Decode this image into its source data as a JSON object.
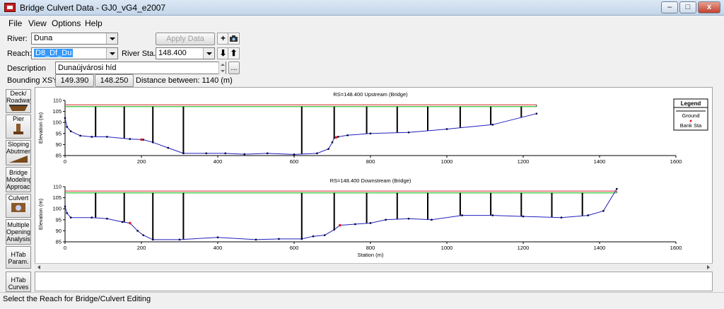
{
  "window": {
    "title": "Bridge Culvert Data - GJ0_vG4_e2007",
    "minimize": "–",
    "maximize": "□",
    "close": "x"
  },
  "menu": [
    "File",
    "View",
    "Options",
    "Help"
  ],
  "form": {
    "river_label": "River:",
    "river_value": "Duna",
    "reach_label": "Reach:",
    "reach_value": "D8_Df_Du",
    "river_sta_label": "River Sta.:",
    "river_sta_value": "148.400",
    "apply_button": "Apply Data",
    "description_label": "Description",
    "description_value": "Dunaújvárosi híd",
    "bounding_label": "Bounding XS's:",
    "bounding_upstream": "149.390",
    "bounding_downstream": "148.250",
    "distance_text": "Distance between: 1140 (m)"
  },
  "sidebar": [
    {
      "label": "Deck/ Roadway",
      "icon": "deck-icon"
    },
    {
      "label": "Pier",
      "icon": "pier-icon"
    },
    {
      "label": "Sloping Abutment",
      "icon": "abutment-icon"
    },
    {
      "label": "Bridge Modeling Approach",
      "icon": ""
    },
    {
      "label": "Culvert",
      "icon": "culvert-icon"
    },
    {
      "label": "Multiple Opening Analysis",
      "icon": ""
    },
    {
      "label": "HTab Param.",
      "icon": ""
    },
    {
      "label": "HTab Curves",
      "icon": ""
    }
  ],
  "legend": {
    "title": "Legend",
    "items": [
      "Ground",
      "Bank Sta"
    ]
  },
  "colors": {
    "ground": "#2020c0",
    "bank": "#e02020",
    "deck_top": "#e05050",
    "deck_bottom": "#30c030",
    "pier": "#000000"
  },
  "chart_data": [
    {
      "type": "line",
      "title": "RS=148.400  Upstream  (Bridge)",
      "ylabel": "Elevation (m)",
      "xlabel": "",
      "xlim": [
        0,
        1600
      ],
      "ylim": [
        85,
        110
      ],
      "xticks": [
        "0",
        "200",
        "400",
        "600",
        "800",
        "1000",
        "1200",
        "1400",
        "1600"
      ],
      "yticks": [
        "85",
        "90",
        "95",
        "100",
        "105",
        "110"
      ],
      "series": [
        {
          "x": [
            0,
            5,
            15,
            40,
            70,
            110,
            170,
            205,
            230,
            270,
            310,
            370,
            420,
            470,
            530,
            600,
            660,
            690,
            700,
            705,
            715,
            740,
            800,
            900,
            1000,
            1120,
            1235
          ],
          "y": [
            102,
            98,
            96,
            94,
            93.5,
            93.5,
            92.5,
            92.2,
            91,
            88.5,
            86,
            86,
            86,
            85.6,
            86,
            85.5,
            86,
            88,
            91,
            93,
            93.5,
            94.2,
            95,
            95.5,
            97,
            99,
            104
          ]
        }
      ],
      "bank_stations": [
        200,
        710
      ],
      "deck": {
        "x_start": 0,
        "x_end": 1235,
        "top": 108,
        "bottom": 107.2
      },
      "piers": [
        80,
        155,
        230,
        310,
        620,
        705,
        790,
        870,
        950,
        1035,
        1115,
        1195
      ],
      "pier_tops": [
        107.2,
        107.2,
        107.2,
        107.2,
        107.2,
        107.2,
        107.2,
        107.2,
        107.2,
        107.2,
        107.2,
        107.2
      ]
    },
    {
      "type": "line",
      "title": "RS=148.400  Downstream  (Bridge)",
      "ylabel": "Elevation (m)",
      "xlabel": "Station (m)",
      "xlim": [
        0,
        1600
      ],
      "ylim": [
        85,
        110
      ],
      "xticks": [
        "0",
        "200",
        "400",
        "600",
        "800",
        "1000",
        "1200",
        "1400",
        "1600"
      ],
      "yticks": [
        "85",
        "90",
        "95",
        "100",
        "105",
        "110"
      ],
      "series": [
        {
          "x": [
            0,
            5,
            15,
            70,
            110,
            150,
            170,
            190,
            205,
            230,
            300,
            400,
            500,
            560,
            620,
            650,
            680,
            705,
            720,
            760,
            800,
            840,
            900,
            960,
            1040,
            1120,
            1200,
            1300,
            1370,
            1410,
            1445
          ],
          "y": [
            101,
            98,
            96,
            96,
            95.5,
            94,
            93.5,
            90,
            88,
            86,
            86,
            87,
            86,
            86.3,
            86.3,
            87.5,
            88,
            90.5,
            92.5,
            93,
            93.5,
            95,
            95.5,
            95,
            97,
            97,
            96.5,
            96,
            97,
            99,
            109
          ]
        }
      ],
      "bank_stations": [
        170,
        720
      ],
      "deck": {
        "x_start": 0,
        "x_end": 1445,
        "top": 108,
        "bottom": 107.2
      },
      "piers": [
        80,
        155,
        230,
        310,
        620,
        705,
        790,
        870,
        950,
        1035,
        1115,
        1195,
        1275,
        1355
      ],
      "pier_tops": [
        107.2,
        107.2,
        107.2,
        107.2,
        107.2,
        107.2,
        107.2,
        107.2,
        107.2,
        107.2,
        107.2,
        107.2,
        107.2,
        107.2
      ]
    }
  ],
  "status": "Select the Reach for Bridge/Culvert Editing"
}
